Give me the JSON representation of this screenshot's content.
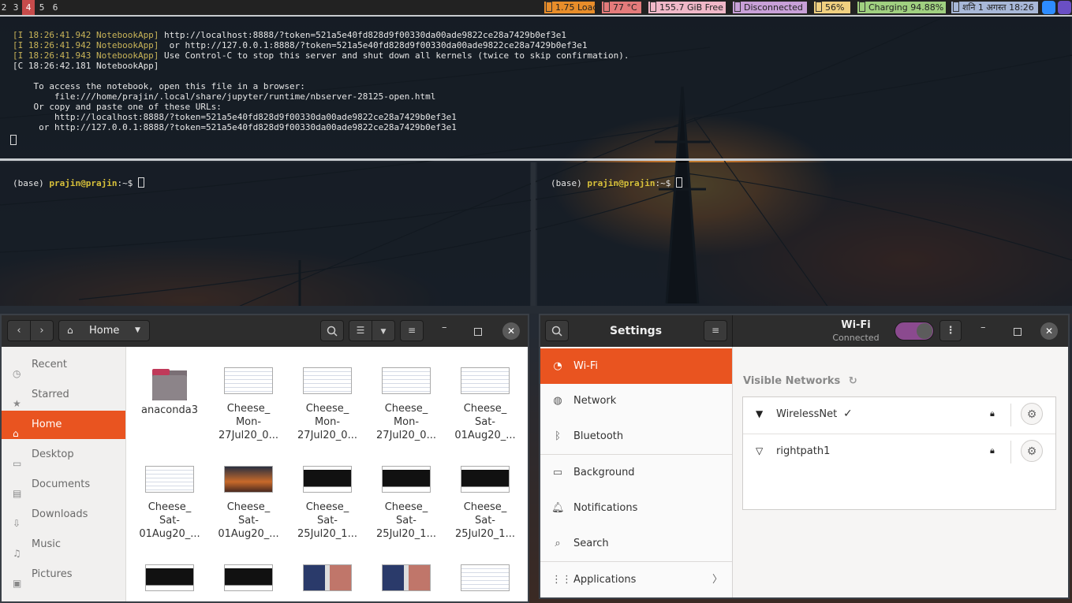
{
  "topbar": {
    "workspaces": [
      "2",
      "3",
      "4",
      "5",
      "6"
    ],
    "active_workspace": "4",
    "load": "1.75 Load",
    "temp": "77 °C",
    "disk": "155.7 GiB Free",
    "network": "Disconnected",
    "cpu": "56%",
    "battery": "Charging 94.88%",
    "datetime": "शनि 1 अगस्त 18:26",
    "colors": {
      "load": "#e88d2a",
      "temp": "#e47b7b",
      "disk": "#f0b8c8",
      "network": "#c8a0d8",
      "cpu": "#f0d080",
      "battery": "#a0d080",
      "datetime": "#a8b8d8"
    }
  },
  "terminal_top": {
    "lines": [
      {
        "prefix": "[I 18:26:41.942 NotebookApp]",
        "text": " http://localhost:8888/?token=521a5e40fd828d9f00330da00ade9822ce28a7429b0ef3e1"
      },
      {
        "prefix": "[I 18:26:41.942 NotebookApp]",
        "text": "  or http://127.0.0.1:8888/?token=521a5e40fd828d9f00330da00ade9822ce28a7429b0ef3e1"
      },
      {
        "prefix": "[I 18:26:41.943 NotebookApp]",
        "text": " Use Control-C to stop this server and shut down all kernels (twice to skip confirmation)."
      },
      {
        "prefix": "",
        "text": "[C 18:26:42.181 NotebookApp]"
      },
      {
        "prefix": "",
        "text": ""
      },
      {
        "prefix": "",
        "text": "    To access the notebook, open this file in a browser:"
      },
      {
        "prefix": "",
        "text": "        file:///home/prajin/.local/share/jupyter/runtime/nbserver-28125-open.html"
      },
      {
        "prefix": "",
        "text": "    Or copy and paste one of these URLs:"
      },
      {
        "prefix": "",
        "text": "        http://localhost:8888/?token=521a5e40fd828d9f00330da00ade9822ce28a7429b0ef3e1"
      },
      {
        "prefix": "",
        "text": "     or http://127.0.0.1:8888/?token=521a5e40fd828d9f00330da00ade9822ce28a7429b0ef3e1"
      }
    ]
  },
  "terminal_left": {
    "env": "(base) ",
    "user": "prajin@prajin",
    "path": ":~$ "
  },
  "terminal_right": {
    "env": "(base) ",
    "user": "prajin@prajin",
    "path": ":~$ "
  },
  "files": {
    "location": "Home",
    "sidebar": [
      "Recent",
      "Starred",
      "Home",
      "Desktop",
      "Documents",
      "Downloads",
      "Music",
      "Pictures"
    ],
    "sidebar_icons": [
      "clock-icon",
      "star-icon",
      "home-icon",
      "desktop-icon",
      "documents-icon",
      "downloads-icon",
      "music-icon",
      "pictures-icon"
    ],
    "active": "Home",
    "items": [
      {
        "l1": "anaconda3",
        "l2": "",
        "l3": "",
        "kind": "folder"
      },
      {
        "l1": "Cheese_",
        "l2": "Mon-",
        "l3": "27Jul20_0...",
        "kind": "doc"
      },
      {
        "l1": "Cheese_",
        "l2": "Mon-",
        "l3": "27Jul20_0...",
        "kind": "doc"
      },
      {
        "l1": "Cheese_",
        "l2": "Mon-",
        "l3": "27Jul20_0...",
        "kind": "doc"
      },
      {
        "l1": "Cheese_",
        "l2": "Sat-",
        "l3": "01Aug20_...",
        "kind": "doc"
      },
      {
        "l1": "Cheese_",
        "l2": "Sat-",
        "l3": "01Aug20_...",
        "kind": "doc"
      },
      {
        "l1": "Cheese_",
        "l2": "Sat-",
        "l3": "01Aug20_...",
        "kind": "sunset"
      },
      {
        "l1": "Cheese_",
        "l2": "Sat-",
        "l3": "25Jul20_1...",
        "kind": "dark"
      },
      {
        "l1": "Cheese_",
        "l2": "Sat-",
        "l3": "25Jul20_1...",
        "kind": "dark"
      },
      {
        "l1": "Cheese_",
        "l2": "Sat-",
        "l3": "25Jul20_1...",
        "kind": "dark"
      },
      {
        "l1": "",
        "l2": "",
        "l3": "",
        "kind": "dark"
      },
      {
        "l1": "",
        "l2": "",
        "l3": "",
        "kind": "dark"
      },
      {
        "l1": "",
        "l2": "",
        "l3": "",
        "kind": "photo"
      },
      {
        "l1": "",
        "l2": "",
        "l3": "",
        "kind": "photo"
      },
      {
        "l1": "",
        "l2": "",
        "l3": "",
        "kind": "doc"
      }
    ]
  },
  "settings": {
    "title": "Settings",
    "panel_title": "Wi-Fi",
    "panel_subtitle": "Connected",
    "menu": [
      {
        "label": "Wi-Fi",
        "icon": "wifi-icon",
        "active": true
      },
      {
        "label": "Network",
        "icon": "network-icon",
        "active": false
      },
      {
        "label": "Bluetooth",
        "icon": "bluetooth-icon",
        "active": false
      },
      {
        "label": "Background",
        "icon": "background-icon",
        "active": false
      },
      {
        "label": "Notifications",
        "icon": "notifications-icon",
        "active": false
      },
      {
        "label": "Search",
        "icon": "search-icon",
        "active": false
      },
      {
        "label": "Applications",
        "icon": "applications-icon",
        "active": false
      }
    ],
    "visible_networks_label": "Visible Networks",
    "networks": [
      {
        "name": "WirelessNet",
        "connected": true,
        "secured": true
      },
      {
        "name": "rightpath1",
        "connected": false,
        "secured": true
      }
    ],
    "accent": "#e95420",
    "toggle_on": true
  }
}
